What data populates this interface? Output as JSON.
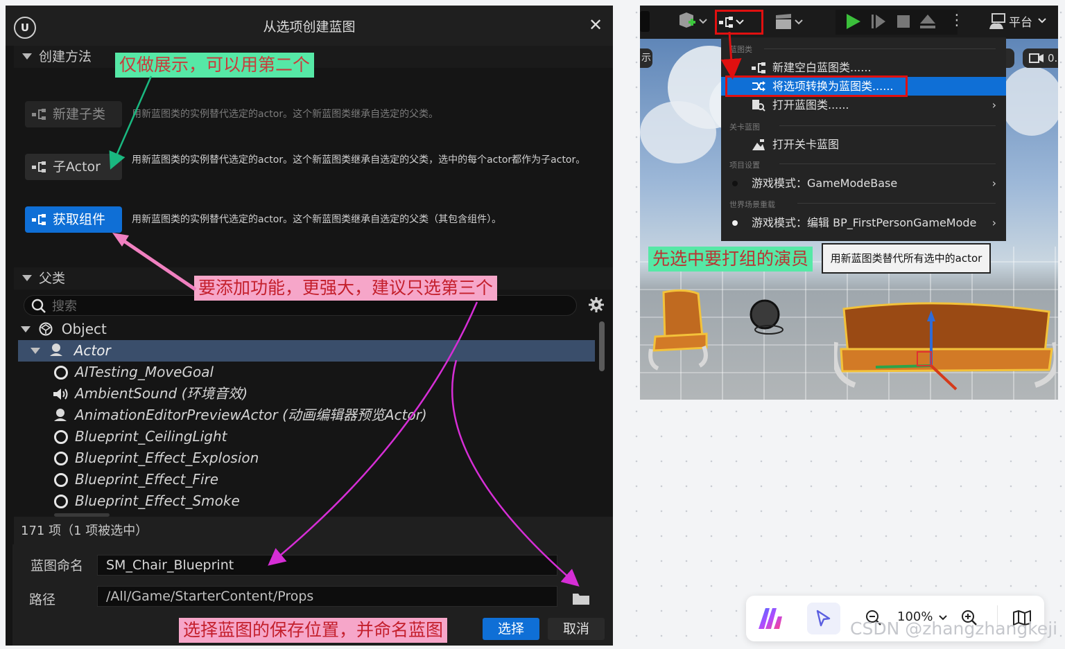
{
  "dialog": {
    "title": "从选项创建蓝图",
    "creation_section": "创建方法",
    "methods": [
      {
        "label": "新建子类",
        "desc": "用新蓝图类的实例替代选定的actor。这个新蓝图类继承自选定的父类。"
      },
      {
        "label": "子Actor",
        "desc": "用新蓝图类的实例替代选定的actor。这个新蓝图类继承自选定的父类，选中的每个actor都作为子actor。"
      },
      {
        "label": "获取组件",
        "desc": "用新蓝图类的实例替代选定的actor。这个新蓝图类继承自选定的父类（其包含组件）。"
      }
    ],
    "parent_section": "父类",
    "search_placeholder": "搜索",
    "tree": [
      {
        "label": "Object"
      },
      {
        "label": "Actor"
      },
      {
        "label": "AITesting_MoveGoal"
      },
      {
        "label": "AmbientSound (环境音效)"
      },
      {
        "label": "AnimationEditorPreviewActor (动画编辑器预览Actor)"
      },
      {
        "label": "Blueprint_CeilingLight"
      },
      {
        "label": "Blueprint_Effect_Explosion"
      },
      {
        "label": "Blueprint_Effect_Fire"
      },
      {
        "label": "Blueprint_Effect_Smoke"
      }
    ],
    "item_count": "171 项（1 项被选中）",
    "name_label": "蓝图命名",
    "name_value": "SM_Chair_Blueprint",
    "path_label": "路径",
    "path_value": "/All/Game/StarterContent/Props",
    "select_button": "选择",
    "cancel_button": "取消"
  },
  "annotations": {
    "note1": "仅做展示，可以用第二个",
    "note2": "要添加功能，更强大，建议只选第三个",
    "note3": "选择蓝图的保存位置，并命名蓝图",
    "note4": "先选中要打组的演员"
  },
  "viewport": {
    "platform_label": "平台",
    "left_edge_text": "示",
    "right_edge_text": "0.",
    "menu": {
      "cat_blueprint": "蓝图类",
      "item_new_empty": "新建空白蓝图类......",
      "item_convert": "将选项转换为蓝图类......",
      "item_open": "打开蓝图类......",
      "cat_level": "关卡蓝图",
      "item_open_level": "打开关卡蓝图",
      "cat_project": "项目设置",
      "item_gamemode": "游戏模式：GameModeBase",
      "cat_world": "世界场景重载",
      "item_world_gamemode": "游戏模式：编辑 BP_FirstPersonGameMode"
    },
    "tooltip": "用新蓝图类替代所有选中的actor"
  },
  "bottom_toolbar": {
    "zoom_level": "100%",
    "watermark": "CSDN @zhangzhangkeji"
  },
  "colors": {
    "accent_blue": "#0f6fd6",
    "annotation_green": "#56e8a6",
    "annotation_pink": "#f6a6c9",
    "highlight_red": "#e01010"
  }
}
